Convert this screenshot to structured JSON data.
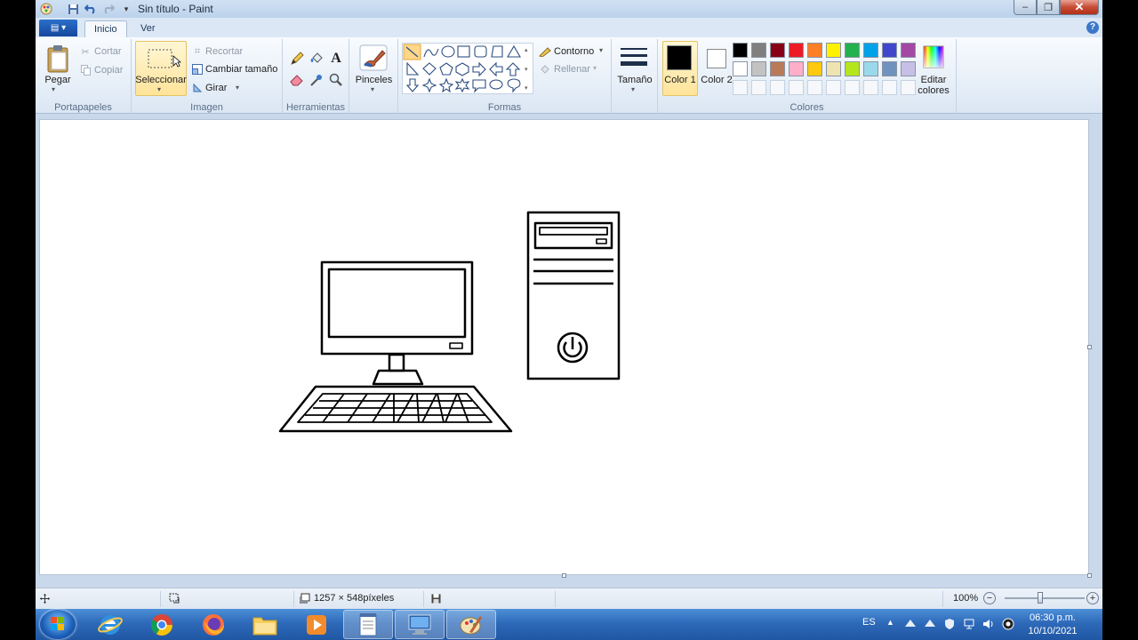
{
  "window": {
    "title": "Sin título - Paint",
    "quick_access": [
      "save-icon",
      "undo-icon",
      "redo-icon",
      "customize-icon"
    ],
    "controls": {
      "minimize": "–",
      "maximize": "❐",
      "close": "✕"
    }
  },
  "tabs": {
    "file_menu_icon": "▤ ▾",
    "items": [
      "Inicio",
      "Ver"
    ],
    "help": "?"
  },
  "ribbon": {
    "clipboard": {
      "group_label": "Portapapeles",
      "paste": "Pegar",
      "cut": "Cortar",
      "copy": "Copiar"
    },
    "image": {
      "group_label": "Imagen",
      "select": "Seleccionar",
      "crop": "Recortar",
      "resize": "Cambiar tamaño",
      "rotate": "Girar"
    },
    "tools": {
      "group_label": "Herramientas",
      "items": [
        "pencil-icon",
        "fill-icon",
        "text-icon",
        "eraser-icon",
        "color-picker-icon",
        "magnifier-icon"
      ]
    },
    "brushes": {
      "label": "Pinceles"
    },
    "shapes": {
      "group_label": "Formas",
      "outline": "Contorno",
      "fill": "Rellenar"
    },
    "size": {
      "label": "Tamaño"
    },
    "colors": {
      "group_label": "Colores",
      "color1_label": "Color 1",
      "color2_label": "Color 2",
      "edit_label": "Editar colores",
      "color1": "#000000",
      "color2": "#ffffff",
      "palette_row1": [
        "#000000",
        "#7f7f7f",
        "#880015",
        "#ed1c24",
        "#ff7f27",
        "#fff200",
        "#22b14c",
        "#00a2e8",
        "#3f48cc",
        "#a349a4"
      ],
      "palette_row2": [
        "#ffffff",
        "#c3c3c3",
        "#b97a57",
        "#ffaec9",
        "#ffc90e",
        "#efe4b0",
        "#b5e61d",
        "#99d9ea",
        "#7092be",
        "#c8bfe7"
      ]
    }
  },
  "status": {
    "dimensions": "1257 × 548píxeles",
    "zoom": "100%",
    "zoom_level": 1.0
  },
  "taskbar": {
    "language": "ES",
    "time": "06:30 p.m.",
    "date": "10/10/2021",
    "apps": [
      "internet-explorer-icon",
      "chrome-icon",
      "firefox-icon",
      "file-explorer-icon",
      "media-player-icon",
      "notepad-icon",
      "computer-icon",
      "paint-icon"
    ]
  }
}
